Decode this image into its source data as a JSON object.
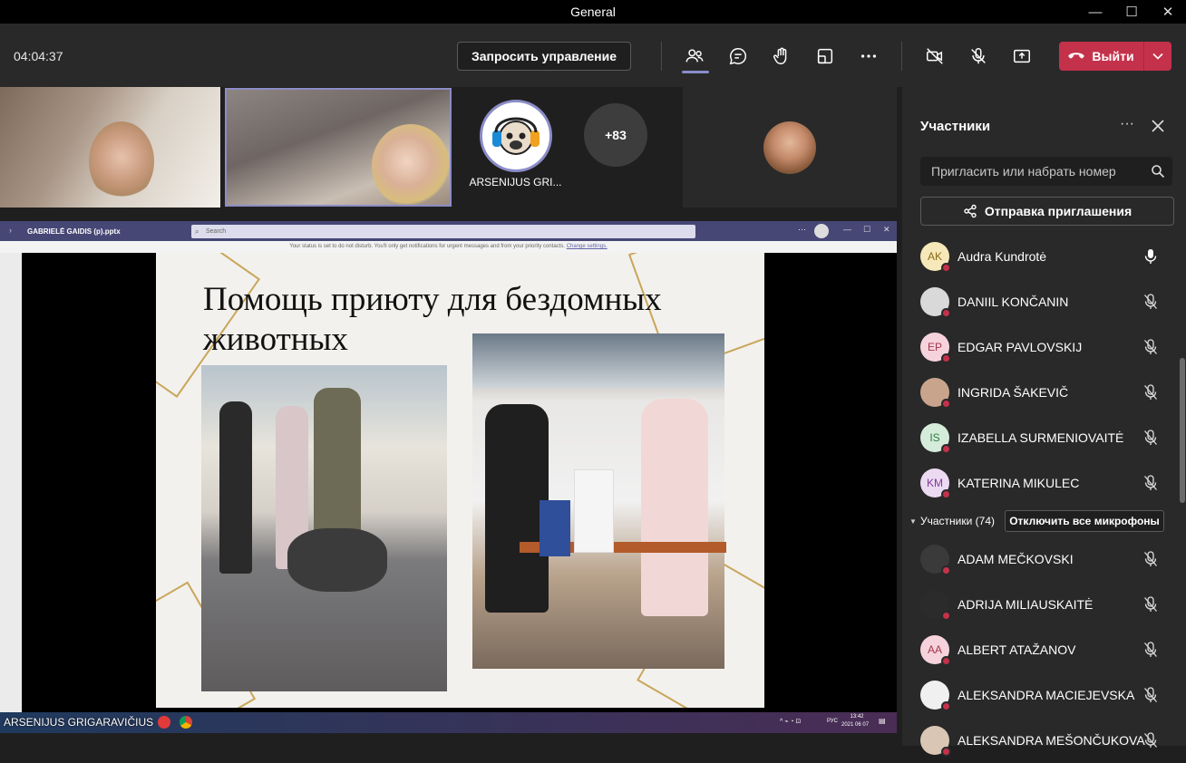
{
  "window": {
    "title": "General",
    "minimize": "—",
    "maximize": "☐",
    "close": "✕"
  },
  "toolbar": {
    "timer": "04:04:37",
    "request_control_label": "Запросить управление",
    "leave_label": "Выйти",
    "leave_color": "#c4314b",
    "accent_color": "#8b8cc7"
  },
  "stage": {
    "avatar_name": "ARSENIJUS GRI...",
    "more_count": "+83",
    "presenter_name": "ARSENIJUS GRIGARAVIČIUS"
  },
  "shared_screen": {
    "window_title": "GABRIELĖ GAIDIS (p).pptx",
    "search_placeholder": "Search",
    "notice": "Your status is set to do not disturb. You'll only get notifications for urgent messages and from your priority contacts.",
    "notice_link": "Change settings.",
    "slide_title": "Помощь приюту для бездомных животных",
    "tray_lang": "РУС",
    "tray_time": "13:42",
    "tray_date": "2021 06 07"
  },
  "panel": {
    "title": "Участники",
    "invite_placeholder": "Пригласить или набрать номер",
    "send_invite_label": "Отправка приглашения",
    "section_label": "Участники (74)",
    "mute_all_label": "Отключить все микрофоны",
    "featured": [
      {
        "name": "Audra Kundrotė",
        "initials": "AK",
        "bg": "#f6e8b8",
        "fg": "#8a6a14",
        "mic": "on"
      },
      {
        "name": "DANIIL KONČANIN",
        "initials": "",
        "bg": "#d9d9d9",
        "fg": "#333",
        "mic": "off"
      },
      {
        "name": "EDGAR PAVLOVSKIJ",
        "initials": "EP",
        "bg": "#f6d3dc",
        "fg": "#a3344d",
        "mic": "off"
      },
      {
        "name": "INGRIDA ŠAKEVIČ",
        "initials": "",
        "bg": "#c9a48c",
        "fg": "#333",
        "mic": "off"
      },
      {
        "name": "IZABELLA SURMENIOVAITĖ",
        "initials": "IS",
        "bg": "#d4ecd9",
        "fg": "#2f7a45",
        "mic": "off"
      },
      {
        "name": "KATERINA MIKULEC",
        "initials": "KM",
        "bg": "#ecdaf2",
        "fg": "#7d3b96",
        "mic": "off"
      }
    ],
    "attendees": [
      {
        "name": "ADAM MEČKOVSKI",
        "initials": "",
        "bg": "#3a3a3a",
        "fg": "#fff",
        "mic": "off"
      },
      {
        "name": "ADRIJA MILIAUSKAITĖ",
        "initials": "",
        "bg": "#2b2b2b",
        "fg": "#fff",
        "mic": "off"
      },
      {
        "name": "ALBERT ATAŽANOV",
        "initials": "AA",
        "bg": "#f6d3dc",
        "fg": "#a3344d",
        "mic": "off"
      },
      {
        "name": "ALEKSANDRA MACIEJEVSKA",
        "initials": "",
        "bg": "#f0f0f0",
        "fg": "#333",
        "mic": "off"
      },
      {
        "name": "ALEKSANDRA MEŠONČUKOVA",
        "initials": "",
        "bg": "#d9c6b5",
        "fg": "#333",
        "mic": "off"
      }
    ]
  }
}
